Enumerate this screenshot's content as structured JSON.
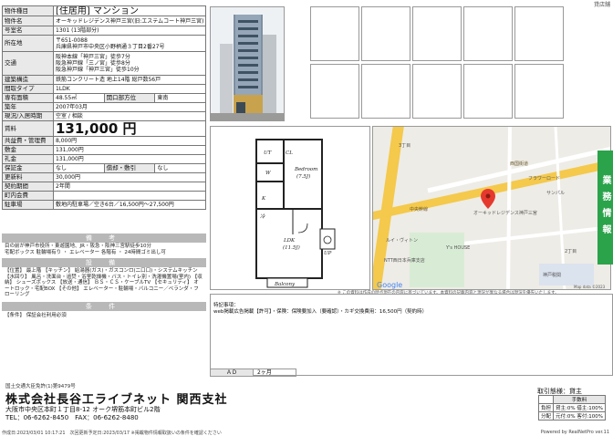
{
  "corner_text": "貸店舗",
  "property": {
    "rows": [
      {
        "label": "物件種目",
        "value": "[住居用] マンション",
        "style": "big"
      },
      {
        "label": "物件名",
        "value": "オーキッドレジデンス神戸三宮(旧:エステムコート神戸三宮)"
      },
      {
        "label": "号室名",
        "value": "1301 (13階部分)"
      },
      {
        "label": "所在地",
        "value": "〒651-0088\n兵庫県神戸市中央区小野柄通３丁目2番27号",
        "style": "ml"
      },
      {
        "label": "交通",
        "value": "阪神本線「神戸三宮」徒歩7分\n阪急神戸線「三ノ宮」徒歩8分\n阪急神戸線「神戸三宮」徒歩10分",
        "style": "ml"
      },
      {
        "label": "建築構造",
        "value": "鉄筋コンクリート造 地上14階 総戸数56戸"
      },
      {
        "label": "間取タイプ",
        "value": "1LDK"
      },
      {
        "label": "専有面積",
        "value": "48.55㎡",
        "extra": [
          {
            "label": "開口部方位",
            "value": "東南"
          }
        ]
      },
      {
        "label": "築年",
        "value": "2007年03月"
      },
      {
        "label": "現況/入居時期",
        "value": "空室 / 相談"
      },
      {
        "label": "賃料",
        "value": "131,000 円",
        "style": "rent"
      },
      {
        "label": "共益費・管理費",
        "value": "8,000円"
      },
      {
        "label": "敷金",
        "value": "131,000円"
      },
      {
        "label": "礼金",
        "value": "131,000円"
      },
      {
        "label": "保証金",
        "value": "なし",
        "extra": [
          {
            "label": "償却・敷引",
            "value": "なし"
          }
        ]
      },
      {
        "label": "更新料",
        "value": "30,000円"
      },
      {
        "label": "契約期間",
        "value": "2年間"
      },
      {
        "label": "町内会費",
        "value": ""
      },
      {
        "label": "駐車場",
        "value": "敷地内駐車場／空き6台／16,500円～27,500円"
      }
    ]
  },
  "remarks": {
    "title": "備 考",
    "text": "目の前が神戸市役所・東遊園地、JR・阪急・阪神三宮駅徒歩10分\n宅配ボックス 駐輪場有り ・ エレベーター 各階有 ・ 24時間ゴミ出し可"
  },
  "facilities": {
    "title": "設 備",
    "text": "【位置】 最上階 【キッチン】 給湯器(ガス)・ガスコンロ(二口口)・システムキッチン 【水回り】 風呂・洗面台・追焚・浴室乾燥機・バス・トイレ別・洗濯機置場(室内) 【収納】 シューズボックス 【放送・通信】 ＢＳ・ＣＳ・ケーブルTV 【セキュリティ】 オートロック・宅配BOX 【その他】 エレベーター・駐輪場・バルコニー／ベランダ・フローリング"
  },
  "conditions": {
    "title": "条 件",
    "text": "【条件】 保証会社利用必須"
  },
  "photos": {
    "thumb_count": 10
  },
  "floor_plan": {
    "room_bedroom": "Bedroom",
    "room_bedroom_size": "(7.5J)",
    "room_ldk": "LDK",
    "room_ldk_size": "(11.5J)",
    "room_balcony": "Balcony",
    "label_ut": "UT",
    "label_cl": "CL",
    "label_k": "K",
    "label_ref": "冷",
    "label_wc": "W",
    "label_up": "UP"
  },
  "map": {
    "label_3chome": "3丁目",
    "label_2chome": "2丁目",
    "label_nishi_dori": "西国街道",
    "label_chuo_dori": "中央幹線",
    "label_building": "オーキッドレジデンス神戸三宮",
    "label_poi1": "フラワーロード",
    "label_poi2": "サンパル",
    "label_poi3": "NTT西日本兵庫支店",
    "label_poi4": "ルイ・ヴィトン",
    "label_poi5": "Y's HOUSE",
    "label_poi6": "神戸税関",
    "label_google": "Google",
    "label_mapdata": "Map data ©2023"
  },
  "map_disclaimer": "※ この資料は作成の時点現在の内容に基づいています。本資料の記載内容と現況が異なる場合は現況を優先いたします。",
  "notes": {
    "label": "特記事項：",
    "text": "web掲載広告掲載【許可】・保険：保険要加入（要確認）・カギ交換費用：16,500円（契約時）"
  },
  "ad_row": {
    "label": "ＡＤ",
    "value": "2ヶ月"
  },
  "side_tab": "業務情報",
  "company": {
    "license": "国土交通大臣免許(1)第9479号",
    "name": "株式会社長谷工ライブネット 関西支社",
    "address": "大阪市中央区本町１丁目8-12 オーク堺筋本町ビル2階",
    "tel_fax": "TEL：06-6262-8450　FAX：06-6262-8480"
  },
  "fee": {
    "title": "取引態様：貸主",
    "header": "手数料",
    "rows": [
      {
        "label": "負担",
        "value": "貸主:0% 借主:100%"
      },
      {
        "label": "分配",
        "value": "元付:0% 客付:100%"
      }
    ]
  },
  "footer": {
    "left": "作成日:2023/03/01 10:17:21　次回更新予定日:2023/03/17 ※掲載物件情報取扱いの条件を確認ください",
    "right": "Powered by RealNetPro ver.11"
  }
}
